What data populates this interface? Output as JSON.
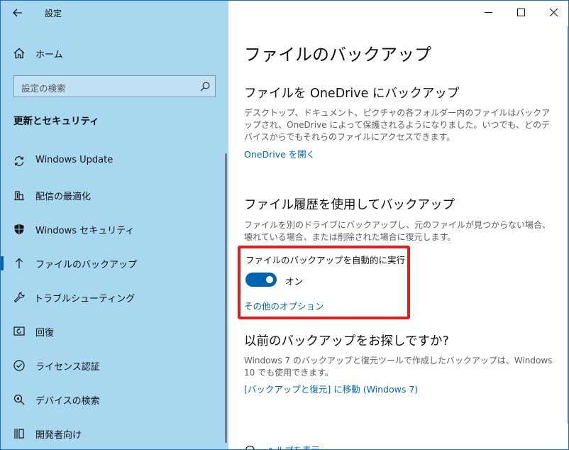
{
  "window": {
    "title": "設定"
  },
  "sidebar": {
    "home_label": "ホーム",
    "search_placeholder": "設定の検索",
    "section_title": "更新とセキュリティ",
    "items": [
      {
        "label": "Windows Update",
        "icon": "sync-icon"
      },
      {
        "label": "配信の最適化",
        "icon": "delivery-optimization-icon"
      },
      {
        "label": "Windows セキュリティ",
        "icon": "shield-icon"
      },
      {
        "label": "ファイルのバックアップ",
        "icon": "backup-arrow-icon",
        "active": true
      },
      {
        "label": "トラブルシューティング",
        "icon": "wrench-icon"
      },
      {
        "label": "回復",
        "icon": "recovery-icon"
      },
      {
        "label": "ライセンス認証",
        "icon": "check-circle-icon"
      },
      {
        "label": "デバイスの検索",
        "icon": "find-device-icon"
      },
      {
        "label": "開発者向け",
        "icon": "developer-icon"
      }
    ]
  },
  "main": {
    "page_title": "ファイルのバックアップ",
    "onedrive": {
      "heading": "ファイルを OneDrive にバックアップ",
      "description": "デスクトップ、ドキュメント、ピクチャの各フォルダー内のファイルはバックアップされ、OneDrive によって保護されるようになりました。いつでも、どのデバイスからでもそれらのファイルにアクセスできます。",
      "link": "OneDrive を開く"
    },
    "file_history": {
      "heading": "ファイル履歴を使用してバックアップ",
      "description": "ファイルを別のドライブにバックアップし、元のファイルが見つからない場合、壊れている場合、または削除された場合に復元します。",
      "toggle_label": "ファイルのバックアップを自動的に実行",
      "toggle_state": "オン",
      "toggle_on": true,
      "more_options": "その他のオプション"
    },
    "older": {
      "heading": "以前のバックアップをお探しですか?",
      "description": "Windows 7 のバックアップと復元ツールで作成したバックアップは、Windows 10 でも使用できます。",
      "link": "[バックアップと復元] に移動 (Windows 7)"
    },
    "help_link": "ヘルプを表示"
  },
  "colors": {
    "sidebar_bg": "#a8d7f0",
    "accent": "#0063b1",
    "link": "#0066b4",
    "highlight_box": "#e01e1e"
  }
}
